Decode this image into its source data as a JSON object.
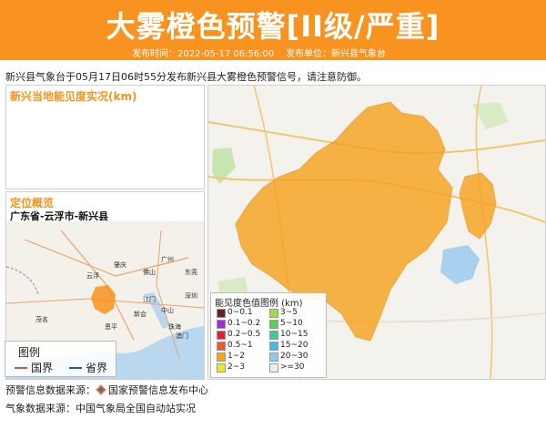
{
  "banner": {
    "title": "大雾橙色预警[II级/严重]",
    "publish_time_label": "发布时间：2022-05-17 06:56:00",
    "publish_unit_label": "发布单位：新兴县气象台",
    "color": "#f7931e"
  },
  "intro": "新兴县气象台于05月17日06时55分发布新兴县大雾橙色预警信号，请注意防御。",
  "visibility_panel": {
    "title": "新兴当地能见度实况(km)"
  },
  "location_panel": {
    "title": "定位概览",
    "region": "广东省-云浮市-新兴县",
    "map_labels": [
      "广州",
      "佛山",
      "江门",
      "云浮",
      "肇庆",
      "东莞",
      "深圳",
      "中山",
      "珠海",
      "澳门",
      "新会",
      "恩平",
      "茂名"
    ]
  },
  "map_legend": {
    "title": "图例",
    "items": [
      {
        "label": "国界",
        "color": "#d9534f"
      },
      {
        "label": "省界",
        "color": "#1e5bbf"
      }
    ]
  },
  "visibility_legend": {
    "title": "能见度色值图例 (km)",
    "items": [
      {
        "label": "0~0.1",
        "color": "#6b1f1f"
      },
      {
        "label": "3~5",
        "color": "#9cdd4a"
      },
      {
        "label": "0.1~0.2",
        "color": "#9b30d9"
      },
      {
        "label": "5~10",
        "color": "#57d14e"
      },
      {
        "label": "0.2~0.5",
        "color": "#e0202a"
      },
      {
        "label": "10~15",
        "color": "#3ec99b"
      },
      {
        "label": "0.5~1",
        "color": "#f05a28"
      },
      {
        "label": "15~20",
        "color": "#48b8e8"
      },
      {
        "label": "1~2",
        "color": "#f7a21b"
      },
      {
        "label": "20~30",
        "color": "#8ec9ee"
      },
      {
        "label": "2~3",
        "color": "#e8e830"
      },
      {
        "label": ">=30",
        "color": "#eeeeee"
      }
    ]
  },
  "sources": {
    "warning": "预警信息数据来源：",
    "warning_center": "国家预警信息发布中心",
    "weather": "气象数据来源：中国气象局全国自动站实况"
  },
  "icons": {
    "warning_source_icon": "diamond-logo-icon"
  }
}
